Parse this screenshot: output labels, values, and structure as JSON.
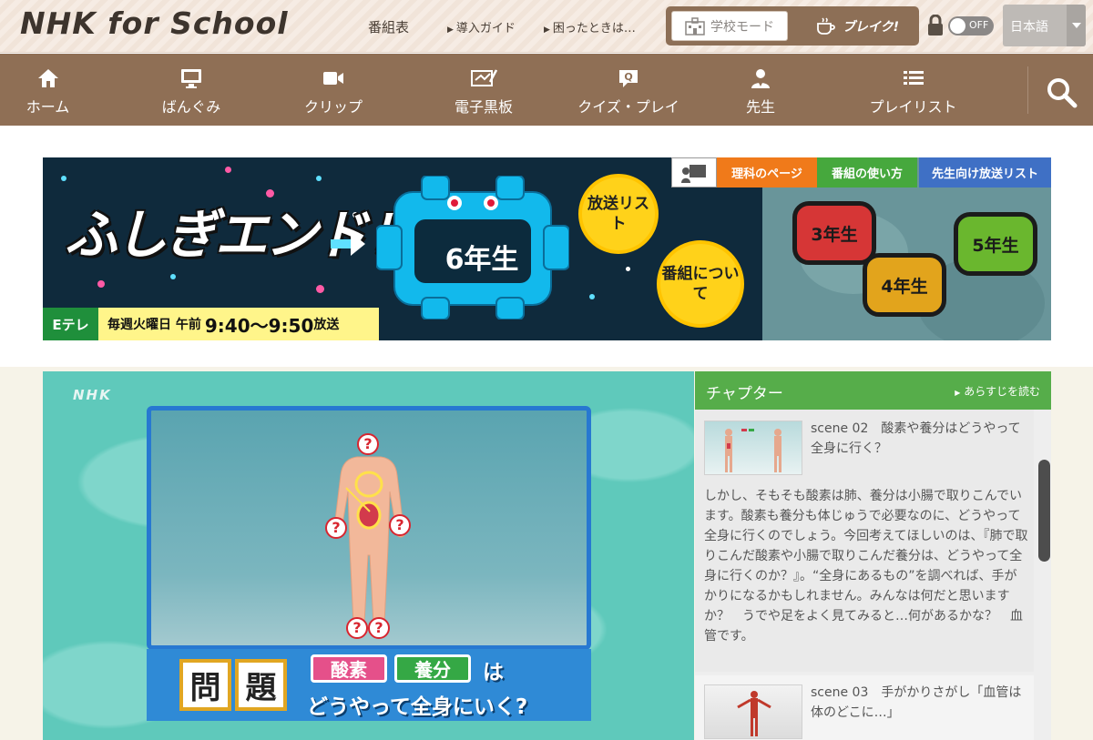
{
  "header": {
    "logo": "NHK for School",
    "links": [
      "番組表",
      "導入ガイド",
      "困ったときは…"
    ],
    "school_mode": "学校モード",
    "break_mode": "ブレイク!",
    "toggle": "OFF",
    "language": "日本語"
  },
  "nav": {
    "items": [
      {
        "label": "ホーム",
        "icon": "home-icon"
      },
      {
        "label": "ばんぐみ",
        "icon": "monitor-icon"
      },
      {
        "label": "クリップ",
        "icon": "video-camera-icon"
      },
      {
        "label": "電子黒板",
        "icon": "blackboard-icon"
      },
      {
        "label": "クイズ・プレイ",
        "icon": "quiz-icon"
      },
      {
        "label": "先生",
        "icon": "teacher-icon"
      },
      {
        "label": "プレイリスト",
        "icon": "list-icon"
      }
    ],
    "search_icon": "search-icon"
  },
  "banner": {
    "title": "ふしぎエンドレス",
    "grade": "6年生",
    "circle1": "放送リスト",
    "circle2": "番組について",
    "tabs": [
      "理科のページ",
      "番組の使い方",
      "先生向け放送リスト"
    ],
    "monsters": [
      "3年生",
      "4年生",
      "5年生"
    ],
    "channel": "Eテレ",
    "schedule_prefix": "毎週火曜日 午前",
    "schedule_time": "9:40～9:50",
    "schedule_suffix": "放送"
  },
  "video": {
    "watermark": "NHK",
    "question_label": [
      "問",
      "題"
    ],
    "tag1": "酸素",
    "tag2": "養分",
    "particle": "は",
    "question_text": "どうやって全身にいく?"
  },
  "chapters": {
    "title": "チャプター",
    "synopsis_link": "あらすじを読む",
    "items": [
      {
        "title": "scene 02　酸素や養分はどうやって全身に行く？",
        "description": "しかし、そもそも酸素は肺、養分は小腸で取りこんでいます。酸素も養分も体じゅうで必要なのに、どうやって全身に行くのでしょう。今回考えてほしいのは、『肺で取りこんだ酸素や小腸で取りこんだ養分は、どうやって全身に行くのか？』。“全身にあるもの”を調べれば、手がかりになるかもしれません。みんなは何だと思いますか？　うでや足をよく見てみると…何があるかな？　血管です。"
      },
      {
        "title": "scene 03　手がかりさがし「血管は体のどこに…」",
        "description": ""
      }
    ]
  },
  "colors": {
    "nav_brown": "#8f6f55",
    "chapter_green": "#56ad4a",
    "video_teal": "#5fc9bb",
    "question_blue": "#2f8ad6"
  }
}
